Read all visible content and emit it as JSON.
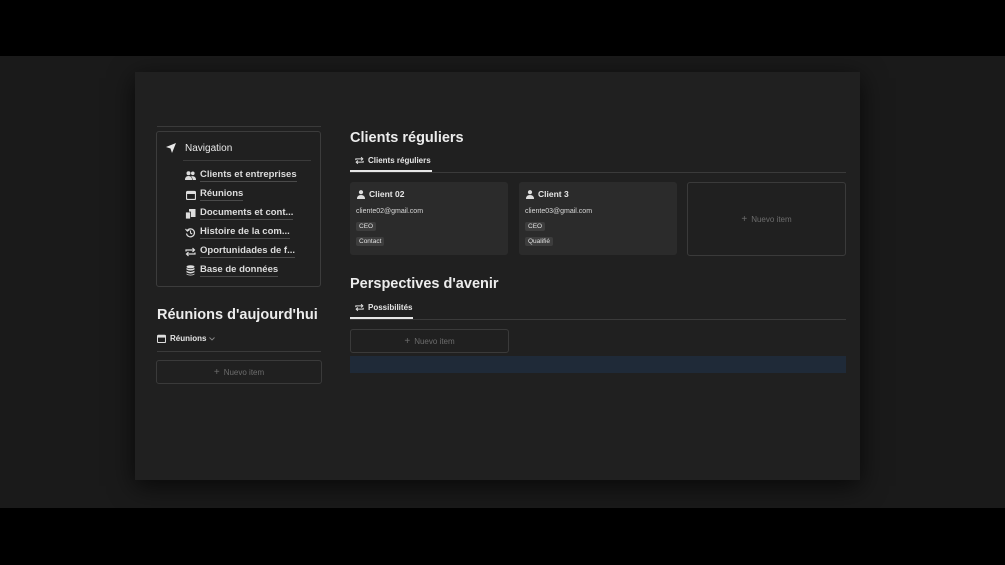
{
  "navigation": {
    "title": "Navigation",
    "items": [
      {
        "label": "Clients et entreprises",
        "icon": "people-icon"
      },
      {
        "label": "Réunions",
        "icon": "calendar-icon"
      },
      {
        "label": "Documents et cont...",
        "icon": "documents-icon"
      },
      {
        "label": "Histoire de la com...",
        "icon": "history-icon"
      },
      {
        "label": "Oportunidades de f...",
        "icon": "repeat-icon"
      },
      {
        "label": "Base de données",
        "icon": "database-icon"
      }
    ]
  },
  "meetings": {
    "title": "Réunions d'aujourd'hui",
    "view_label": "Réunions",
    "new_item": "Nuevo item"
  },
  "regular_clients": {
    "title": "Clients réguliers",
    "tab_label": "Clients réguliers",
    "cards": [
      {
        "name": "Client 02",
        "email": "cliente02@gmail.com",
        "role": "CEO",
        "status": "Contact"
      },
      {
        "name": "Client 3",
        "email": "cliente03@gmail.com",
        "role": "CEO",
        "status": "Qualifié"
      }
    ],
    "new_item": "Nuevo item"
  },
  "prospects": {
    "title": "Perspectives d'avenir",
    "tab_label": "Possibilités",
    "new_item": "Nuevo item"
  },
  "colors": {
    "page_background": "#202020",
    "card_background": "#2b2b2b",
    "highlight_bar": "#1f2a38"
  }
}
